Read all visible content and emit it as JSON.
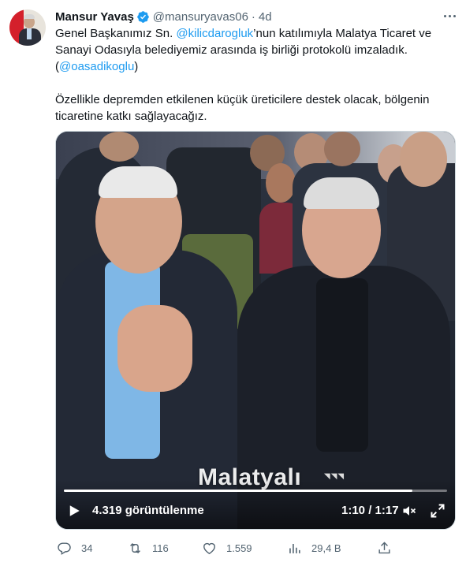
{
  "author": {
    "name": "Mansur Yavaş",
    "handle": "@mansuryavas06",
    "separator": "·",
    "time": "4d"
  },
  "tweet": {
    "line1_prefix": "Genel Başkanımız Sn. ",
    "mention1": "@kilicdarogluk",
    "line1_suffix": "’nun katılımıyla Malatya Ticaret ve Sanayi Odasıyla belediyemiz arasında iş birliği protokolü imzaladık. (",
    "mention2": "@oasadikoglu",
    "line2_suffix": ")",
    "paragraph2": "Özellikle depremden etkilenen küçük üreticilere destek olacak, bölgenin ticaretine katkı sağlayacağız."
  },
  "video": {
    "caption": "Malatyalı",
    "views": "4.319 görüntülenme",
    "current_time": "1:10",
    "time_separator": " / ",
    "duration": "1:17",
    "progress_fraction": 0.91
  },
  "actions": {
    "replies": "34",
    "retweets": "116",
    "likes": "1.559",
    "views": "29,4 B"
  },
  "icons": {
    "verified": "verified-badge-icon",
    "more": "more-options-icon",
    "play": "play-icon",
    "volume": "volume-muted-icon",
    "fullscreen": "fullscreen-icon",
    "reply": "reply-icon",
    "retweet": "retweet-icon",
    "like": "heart-icon",
    "analytics": "analytics-icon",
    "share": "share-icon"
  },
  "colors": {
    "link": "#1d9bf0",
    "secondary_text": "#536471",
    "verified": "#1d9bf0"
  }
}
